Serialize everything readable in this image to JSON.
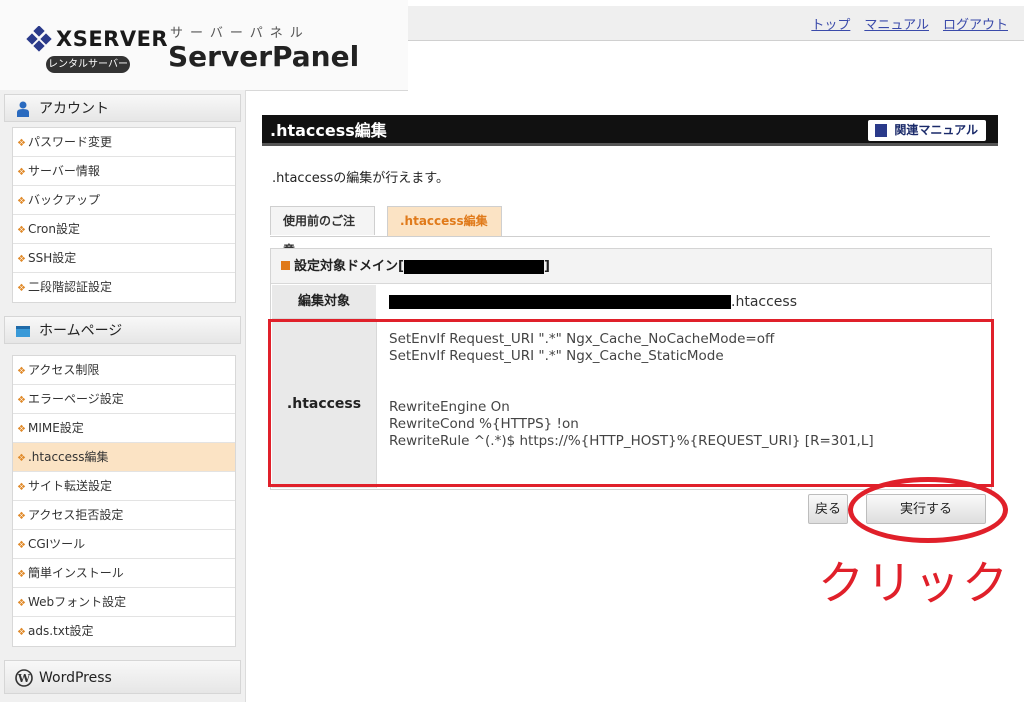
{
  "header": {
    "brand": "XSERVER",
    "badge": "レンタルサーバー",
    "sub_title": "サーバーパネル",
    "main_title": "ServerPanel",
    "links": [
      "トップ",
      "マニュアル",
      "ログアウト"
    ]
  },
  "sidebar": {
    "account": {
      "title": "アカウント",
      "items": [
        "パスワード変更",
        "サーバー情報",
        "バックアップ",
        "Cron設定",
        "SSH設定",
        "二段階認証設定"
      ]
    },
    "homepage": {
      "title": "ホームページ",
      "items": [
        "アクセス制限",
        "エラーページ設定",
        "MIME設定",
        ".htaccess編集",
        "サイト転送設定",
        "アクセス拒否設定",
        "CGIツール",
        "簡単インストール",
        "Webフォント設定",
        "ads.txt設定"
      ],
      "active_item": ".htaccess編集"
    },
    "wordpress": {
      "title": "WordPress"
    }
  },
  "main": {
    "title": ".htaccess編集",
    "manual_button": "関連マニュアル",
    "description": ".htaccessの編集が行えます。",
    "tabs": [
      "使用前のご注意",
      ".htaccess編集"
    ],
    "active_tab": ".htaccess編集",
    "domain_label_prefix": "設定対象ドメイン[",
    "domain_label_suffix": "]",
    "edit_target_label": "編集対象",
    "edit_target_suffix": ".htaccess",
    "htaccess_label": ".htaccess",
    "htaccess_content": "SetEnvIf Request_URI \".*\" Ngx_Cache_NoCacheMode=off\nSetEnvIf Request_URI \".*\" Ngx_Cache_StaticMode\n\n\nRewriteEngine On\nRewriteCond %{HTTPS} !on\nRewriteRule ^(.*)$ https://%{HTTP_HOST}%{REQUEST_URI} [R=301,L]",
    "back_button": "戻る",
    "execute_button": "実行する"
  },
  "annotation": {
    "click_text": "クリック",
    "color": "#e0202a"
  },
  "colors": {
    "accent_orange": "#e07a1a",
    "active_bg": "#fbe3c4",
    "link": "#3a4aaa"
  }
}
